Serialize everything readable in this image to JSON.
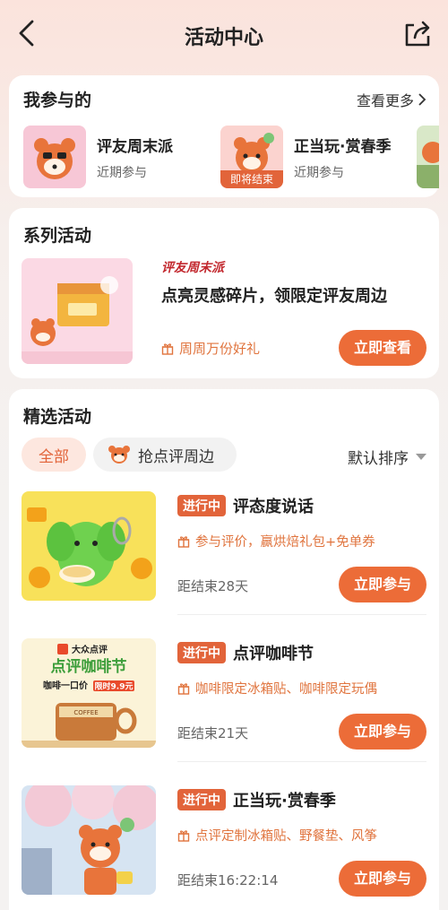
{
  "header": {
    "title": "活动中心",
    "back_icon": "chevron-left-icon",
    "share_icon": "share-icon"
  },
  "participated": {
    "title": "我参与的",
    "more_label": "查看更多",
    "items": [
      {
        "name": "评友周末派",
        "sub": "近期参与"
      },
      {
        "name": "正当玩·赏春季",
        "sub": "近期参与",
        "badge": "即将结束"
      }
    ]
  },
  "series": {
    "title": "系列活动",
    "brand": "评友周末派",
    "headline": "点亮灵感碎片，领限定评友周边",
    "perk": "周周万份好礼",
    "button": "立即查看"
  },
  "featured": {
    "title": "精选活动",
    "filters": [
      "全部",
      "抢点评周边"
    ],
    "sort_label": "默认排序",
    "activities": [
      {
        "status": "进行中",
        "name": "评态度说话",
        "perk": "参与评价，赢烘焙礼包+免单券",
        "timer": "距结束28天",
        "button": "立即参与"
      },
      {
        "status": "进行中",
        "name": "点评咖啡节",
        "perk": "咖啡限定冰箱贴、咖啡限定玩偶",
        "timer": "距结束21天",
        "button": "立即参与"
      },
      {
        "status": "进行中",
        "name": "正当玩·赏春季",
        "perk": "点评定制冰箱贴、野餐垫、风筝",
        "timer": "距结束16:22:14",
        "button": "立即参与"
      }
    ],
    "coffee_poster": {
      "brand": "大众点评",
      "title": "点评咖啡节",
      "slogan": "咖啡一口价",
      "price": "限时9.9元",
      "cup_label": "COFFEE"
    }
  },
  "colors": {
    "accent": "#ec6c38",
    "badge": "#e2643a",
    "perk_text": "#e0743e",
    "header_bg": "#fbe3dc"
  }
}
